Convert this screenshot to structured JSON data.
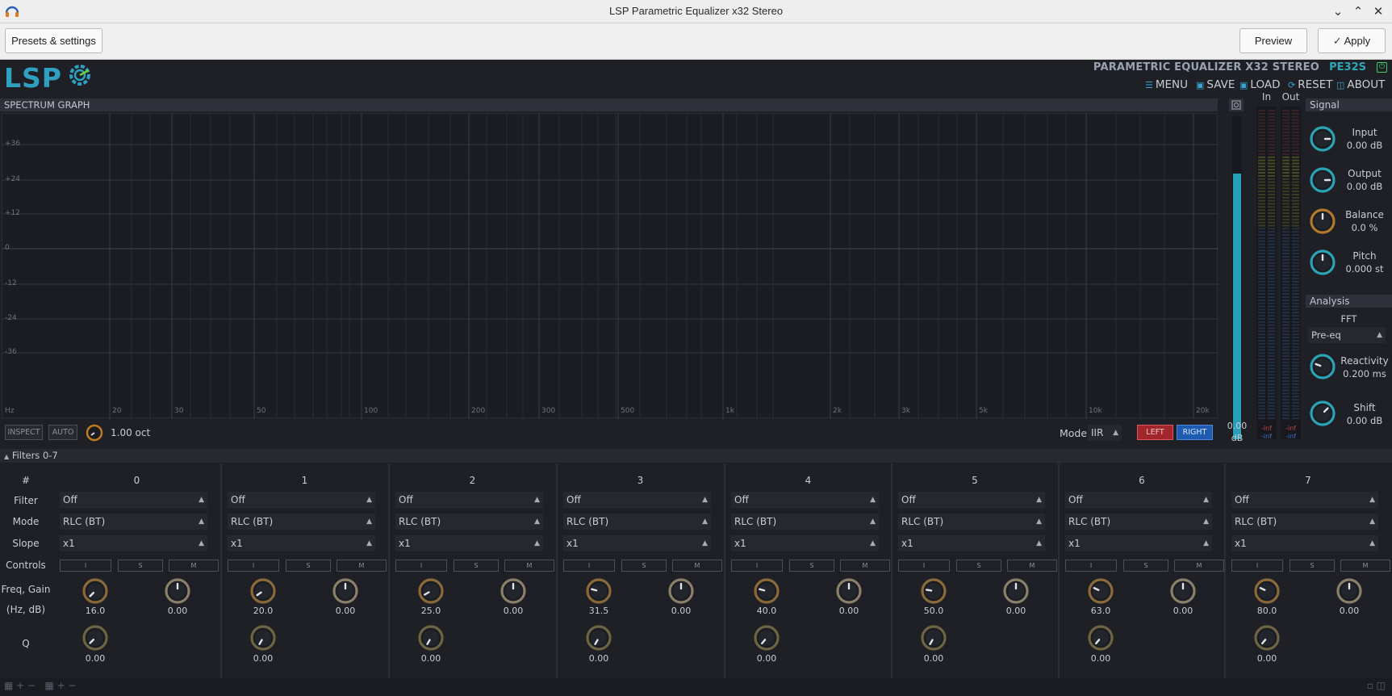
{
  "window": {
    "title": "LSP Parametric Equalizer x32 Stereo"
  },
  "toolbar": {
    "presets_label": "Presets & settings",
    "preview_label": "Preview",
    "apply_label": "Apply"
  },
  "header": {
    "logo": "LSP",
    "plugin_title": "PARAMETRIC EQUALIZER X32 STEREO",
    "plugin_code": "PE32S",
    "menu": [
      {
        "label": "MENU"
      },
      {
        "label": "SAVE"
      },
      {
        "label": "LOAD"
      },
      {
        "label": "RESET"
      },
      {
        "label": "ABOUT"
      }
    ]
  },
  "graph": {
    "title": "SPECTRUM GRAPH",
    "db_labels": [
      "+36",
      "+24",
      "+12",
      "0",
      "-12",
      "-24",
      "-36"
    ],
    "freq_labels": [
      "Hz",
      "20",
      "30",
      "50",
      "100",
      "200",
      "300",
      "500",
      "1k",
      "2k",
      "3k",
      "5k",
      "10k",
      "20k"
    ],
    "inspect_label": "INSPECT",
    "auto_label": "AUTO",
    "zoom_value": "1.00 oct",
    "mode_label": "Mode",
    "mode_value": "IIR",
    "left_label": "LEFT",
    "right_label": "RIGHT"
  },
  "gain_meter": {
    "value": "0.00",
    "unit": "dB",
    "level": 0.99
  },
  "meters": {
    "in_label": "In",
    "out_label": "Out",
    "in_values": [
      "-inf",
      "-inf"
    ],
    "out_values": [
      "-inf",
      "-inf"
    ]
  },
  "signal": {
    "title": "Signal",
    "knobs": [
      {
        "label": "Input",
        "value": "0.00 dB"
      },
      {
        "label": "Output",
        "value": "0.00 dB"
      },
      {
        "label": "Balance",
        "value": "0.0 %"
      },
      {
        "label": "Pitch",
        "value": "0.000 st"
      }
    ]
  },
  "analysis": {
    "title": "Analysis",
    "fft_label": "FFT",
    "fft_value": "Pre-eq",
    "knobs": [
      {
        "label": "Reactivity",
        "value": "0.200 ms"
      },
      {
        "label": "Shift",
        "value": "0.00 dB"
      }
    ]
  },
  "filters": {
    "title": "Filters 0-7",
    "row_labels": {
      "num": "#",
      "filter": "Filter",
      "mode": "Mode",
      "slope": "Slope",
      "controls": "Controls",
      "freq_gain": "Freq, Gain",
      "units": "(Hz, dB)",
      "q": "Q"
    },
    "ctl_labels": [
      "I",
      "S",
      "M"
    ],
    "columns": [
      {
        "num": "0",
        "filter": "Off",
        "mode": "RLC (BT)",
        "slope": "x1",
        "freq": "16.0",
        "gain": "0.00",
        "q": "0.00"
      },
      {
        "num": "1",
        "filter": "Off",
        "mode": "RLC (BT)",
        "slope": "x1",
        "freq": "20.0",
        "gain": "0.00",
        "q": "0.00"
      },
      {
        "num": "2",
        "filter": "Off",
        "mode": "RLC (BT)",
        "slope": "x1",
        "freq": "25.0",
        "gain": "0.00",
        "q": "0.00"
      },
      {
        "num": "3",
        "filter": "Off",
        "mode": "RLC (BT)",
        "slope": "x1",
        "freq": "31.5",
        "gain": "0.00",
        "q": "0.00"
      },
      {
        "num": "4",
        "filter": "Off",
        "mode": "RLC (BT)",
        "slope": "x1",
        "freq": "40.0",
        "gain": "0.00",
        "q": "0.00"
      },
      {
        "num": "5",
        "filter": "Off",
        "mode": "RLC (BT)",
        "slope": "x1",
        "freq": "50.0",
        "gain": "0.00",
        "q": "0.00"
      },
      {
        "num": "6",
        "filter": "Off",
        "mode": "RLC (BT)",
        "slope": "x1",
        "freq": "63.0",
        "gain": "0.00",
        "q": "0.00"
      },
      {
        "num": "7",
        "filter": "Off",
        "mode": "RLC (BT)",
        "slope": "x1",
        "freq": "80.0",
        "gain": "0.00",
        "q": "0.00"
      }
    ]
  },
  "colors": {
    "accent": "#2fa0c0",
    "knob_teal": "#2aa3b5",
    "knob_orange": "#b07a2a",
    "knob_olive": "#8a7f45",
    "left_btn": "#c8383c",
    "right_btn": "#2d6fc9"
  }
}
